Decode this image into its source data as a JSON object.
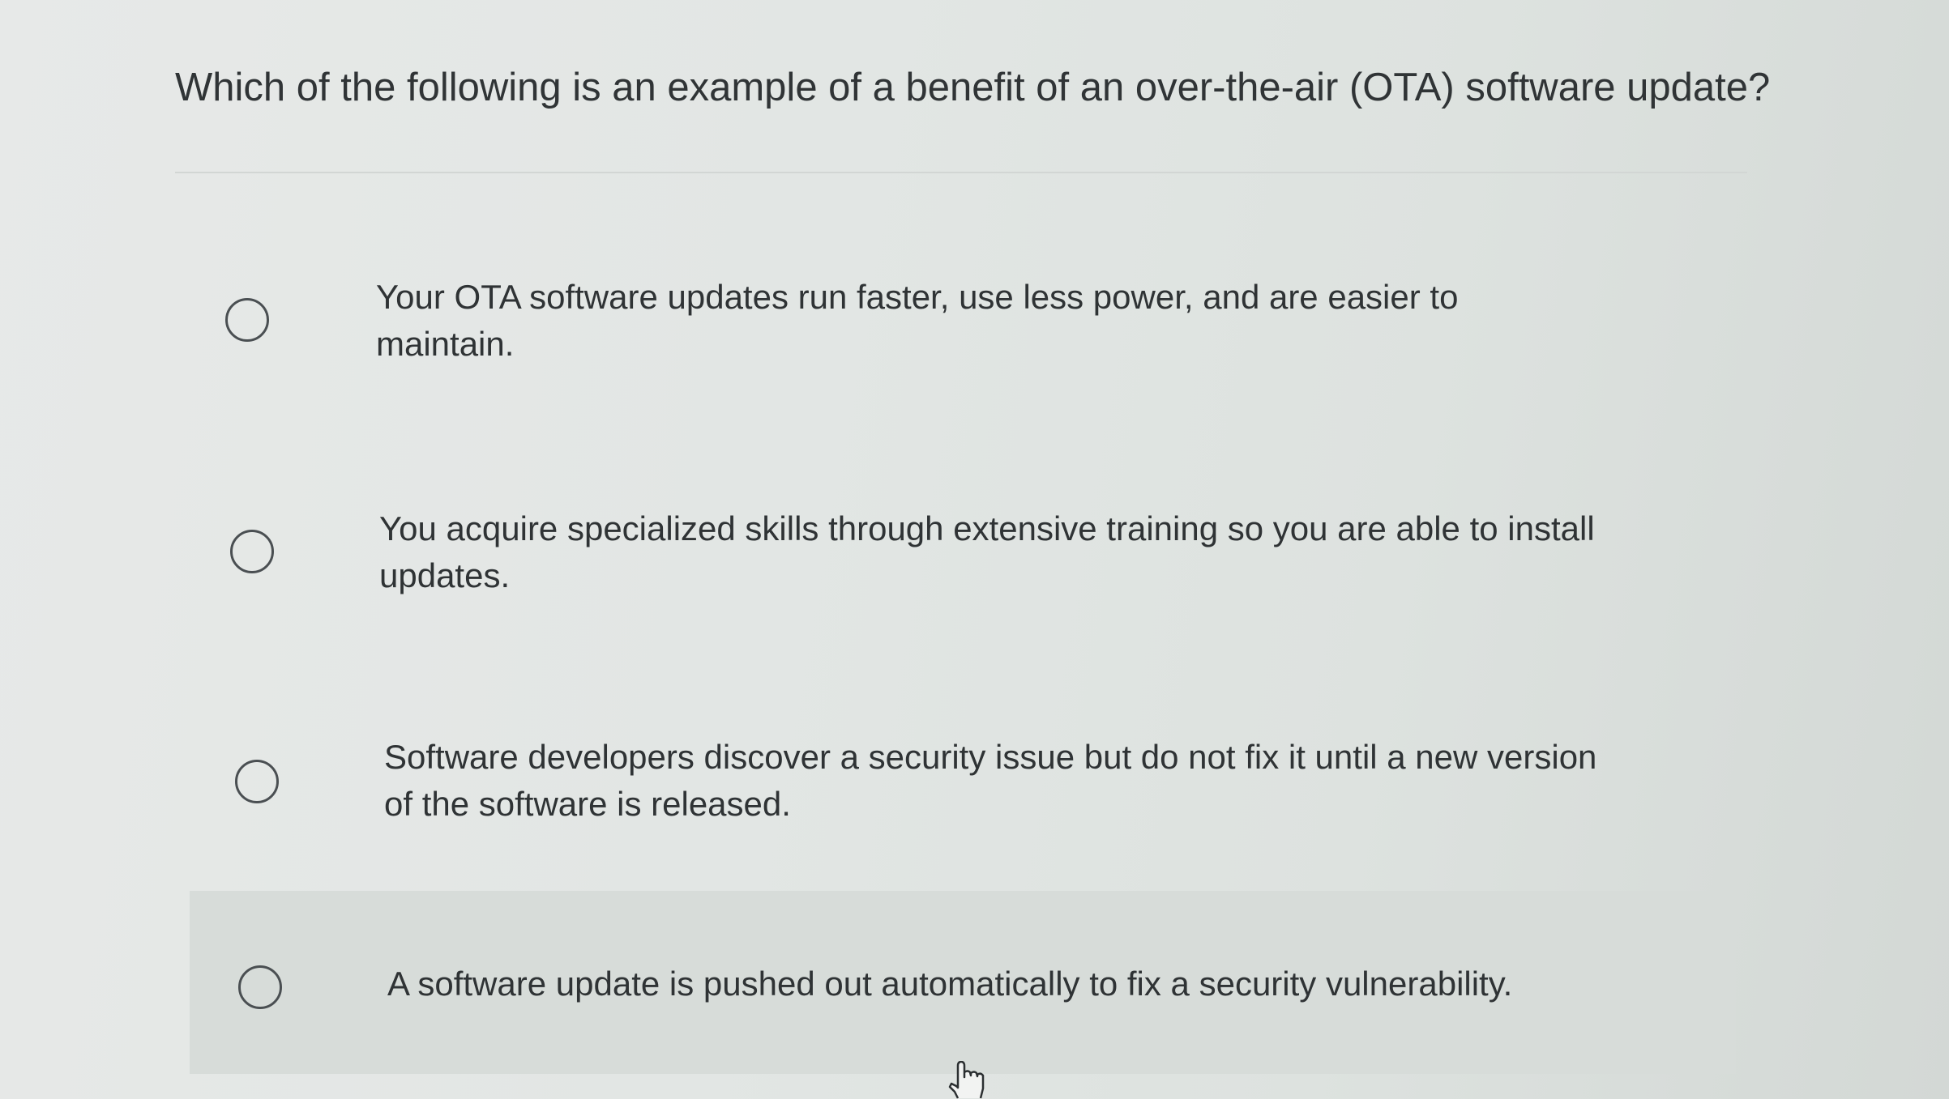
{
  "question": {
    "text": "Which of the following is an example of a benefit of an over-the-air (OTA) software update?"
  },
  "options": [
    {
      "label": "Your OTA software updates run faster, use less power, and are easier to maintain.",
      "selected": false
    },
    {
      "label": "You acquire specialized skills through extensive training so you are able to install updates.",
      "selected": false
    },
    {
      "label": "Software developers discover a security issue but do not fix it until a new version of the software is released.",
      "selected": false
    },
    {
      "label": "A software update is pushed out automatically to fix a security vulnerability.",
      "selected": false,
      "hovered": true
    }
  ],
  "icons": {
    "radio": "radio-button-icon",
    "cursor": "hand-pointer-icon"
  },
  "colors": {
    "text": "#2f3335",
    "radio_border": "#4a4f52",
    "hover_background": "#d7dcd9"
  }
}
